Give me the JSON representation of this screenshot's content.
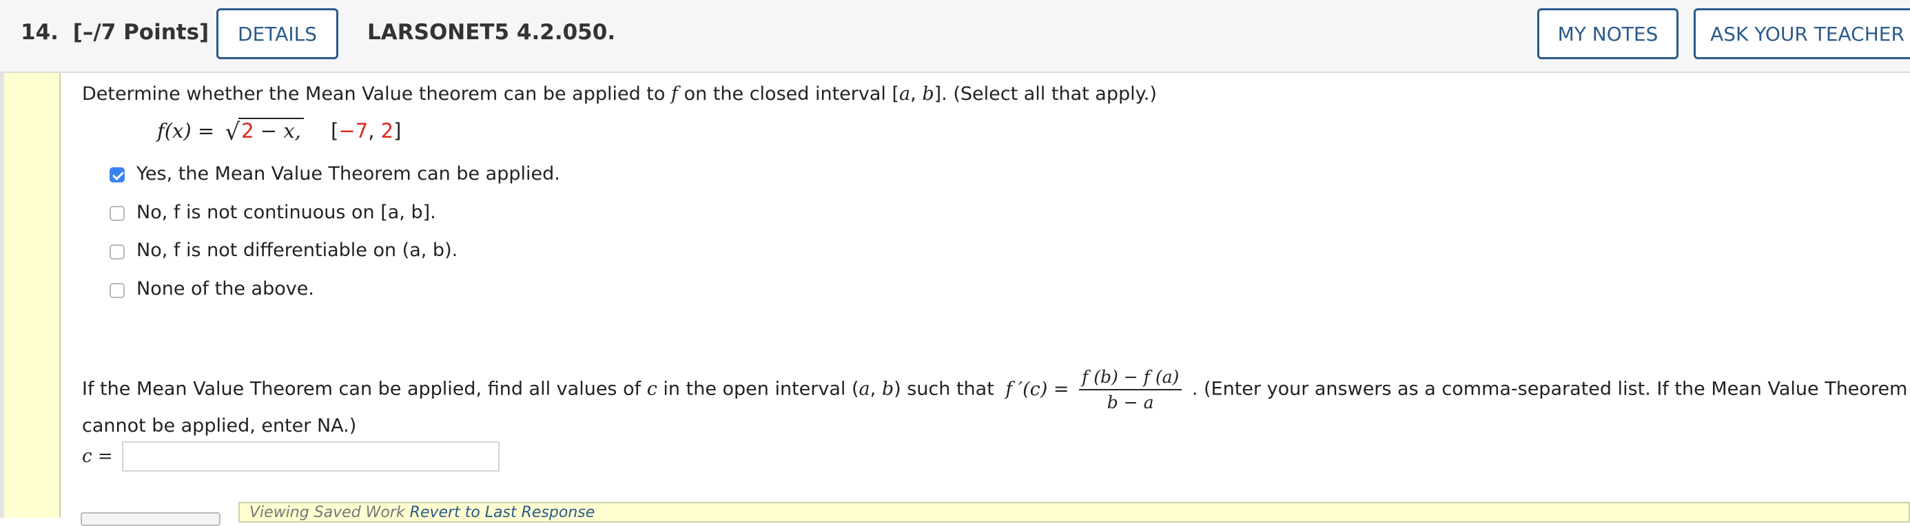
{
  "header": {
    "question_number": "14.",
    "points": "[–/7 Points]",
    "details_label": "DETAILS",
    "problem_code": "LARSONET5 4.2.050.",
    "my_notes_label": "MY NOTES",
    "ask_teacher_label": "ASK YOUR TEACHER"
  },
  "question": {
    "prompt_before_f": "Determine whether the Mean Value theorem can be applied to",
    "prompt_f": "f",
    "prompt_after_f": "on the closed interval [",
    "prompt_a": "a",
    "prompt_comma": ", ",
    "prompt_b": "b",
    "prompt_end": "]. (Select all that apply.)",
    "function_lhs": "f(x) =",
    "radicand_number": "2",
    "radicand_rest": " − x,",
    "interval_open": "[",
    "interval_left": "−7",
    "interval_sep": ", ",
    "interval_right": "2",
    "interval_close": "]"
  },
  "options": [
    {
      "label": "Yes, the Mean Value Theorem can be applied.",
      "checked": true
    },
    {
      "label": "No, f is not continuous on [a, b].",
      "checked": false
    },
    {
      "label": "No, f is not differentiable on (a, b).",
      "checked": false
    },
    {
      "label": "None of the above.",
      "checked": false
    }
  ],
  "part2": {
    "text_start": "If the Mean Value Theorem can be applied, find all values of",
    "c": "c",
    "text_mid": "in the open interval (",
    "a": "a",
    "sep": ", ",
    "b": "b",
    "text_after_interval": ") such that",
    "fprime": "f ′(c) =",
    "frac_num": "f (b) − f (a)",
    "frac_den": "b − a",
    "text_end": ". (Enter your answers as a comma-separated list. If the Mean Value Theorem",
    "line2": "cannot be applied, enter NA.)",
    "answer_label": "c =",
    "answer_value": ""
  },
  "footer": {
    "saved_text": "Viewing Saved Work",
    "revert_link": "Revert to Last Response"
  },
  "colors": {
    "accent": "#2a5a8a",
    "highlight": "#d9261c",
    "stripe": "#fffed0",
    "checkbox": "#3b82f0"
  }
}
